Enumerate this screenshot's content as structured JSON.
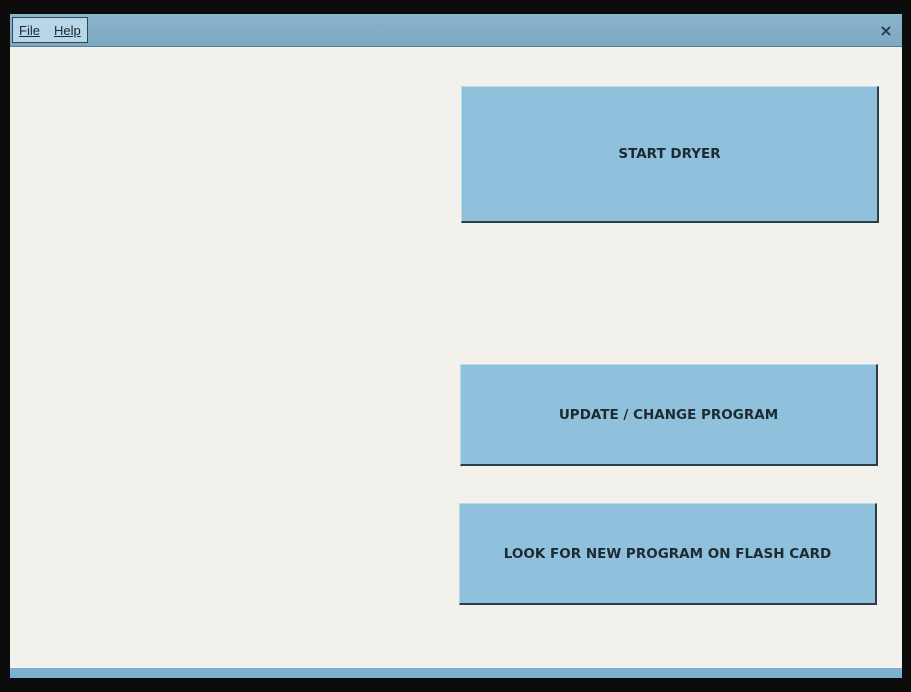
{
  "menubar": {
    "items": [
      {
        "label": "File"
      },
      {
        "label": "Help"
      }
    ],
    "close_label": "×"
  },
  "buttons": {
    "start_dryer": "START DRYER",
    "update_program": "UPDATE / CHANGE PROGRAM",
    "look_flash_card": "LOOK FOR NEW PROGRAM ON FLASH CARD"
  },
  "colors": {
    "background": "#f3f1eb",
    "button_fill": "#8fc1dc",
    "menubar": "#8ab4cc"
  }
}
